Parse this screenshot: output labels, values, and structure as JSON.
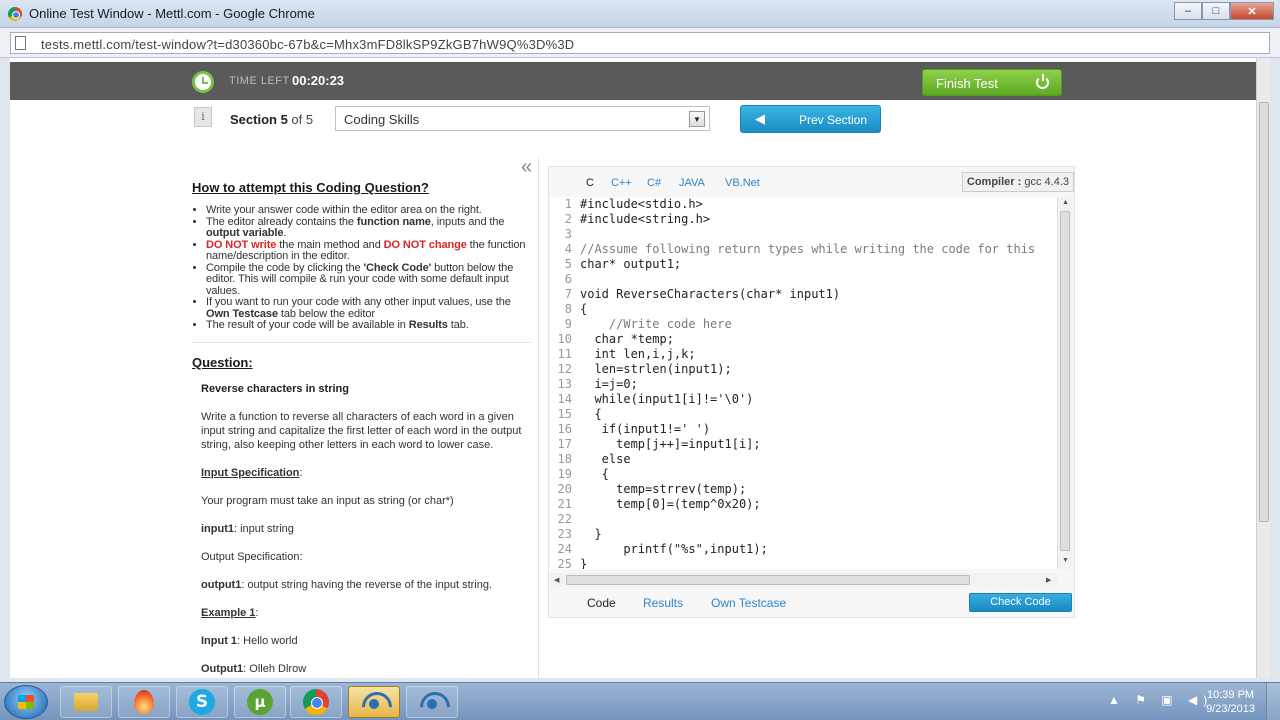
{
  "window": {
    "title": "Online Test Window - Mettl.com - Google Chrome",
    "url": "tests.mettl.com/test-window?t=d30360bc-67b&c=Mhx3mFD8lkSP9ZkGB7hW9Q%3D%3D",
    "buttons": {
      "minimize": "–",
      "maximize": "□",
      "close": "✕"
    }
  },
  "header": {
    "time_label": "TIME LEFT",
    "time_value": "00:20:23",
    "finish_button": "Finish Test"
  },
  "section": {
    "label": "Section 5",
    "of_label": " of 5",
    "select_value": "Coding Skills",
    "prev_button": "Prev Section"
  },
  "instructions": {
    "heading": "How to attempt this Coding Question?",
    "bullets": {
      "b1": "Write your answer code within the editor area on the right.",
      "b2_a": "The editor already contains the ",
      "b2_b": "function name",
      "b2_c": ", inputs and the ",
      "b2_d": "output variable",
      "b2_e": ".",
      "b3_a": "DO NOT write",
      "b3_b": " the main method and ",
      "b3_c": "DO NOT change",
      "b3_d": " the function name/description in the editor.",
      "b4_a": "Compile the code by clicking the ",
      "b4_b": "'Check Code'",
      "b4_c": " button below the editor. This will compile & run your code with some default input values.",
      "b5_a": "If you want to run your code with any other input values, use the ",
      "b5_b": "Own Testcase",
      "b5_c": " tab below the editor",
      "b6_a": "The result of your code will be available in ",
      "b6_b": "Results",
      "b6_c": " tab."
    }
  },
  "question": {
    "heading": "Question:",
    "title": "Reverse characters in string",
    "description": "Write a function to reverse all characters of each word in a given input string and capitalize the first letter of each word in the output string, also keeping other letters in each word to lower case.",
    "input_spec_heading": "Input Specification",
    "input_spec_colon": ":",
    "input_spec_text": "Your program must take an input as string (or char*)",
    "input1_label": "input1",
    "input1_text": ":  input string",
    "output_spec": "Output Specification:",
    "output1_label": "output1",
    "output1_text": ":  output string having the reverse of the input string.",
    "example_heading": "Example 1",
    "example_colon": ":",
    "example_input_label": "Input 1",
    "example_input_text": ": Hello world",
    "example_output_label": "Output1",
    "example_output_text": ": Olleh Dlrow"
  },
  "editor": {
    "tabs": [
      "C",
      "C++",
      "C#",
      "JAVA",
      "VB.Net"
    ],
    "compiler_label": "Compiler :",
    "compiler_value": " gcc 4.4.3",
    "code": [
      {
        "n": "1",
        "t": "#include<stdio.h>"
      },
      {
        "n": "2",
        "t": "#include<string.h>"
      },
      {
        "n": "3",
        "t": ""
      },
      {
        "n": "4",
        "t": "//Assume following return types while writing the code for this"
      },
      {
        "n": "5",
        "t": "char* output1;"
      },
      {
        "n": "6",
        "t": ""
      },
      {
        "n": "7",
        "t": "void ReverseCharacters(char* input1)"
      },
      {
        "n": "8",
        "t": "{"
      },
      {
        "n": "9",
        "t": "    //Write code here"
      },
      {
        "n": "10",
        "t": "  char *temp;"
      },
      {
        "n": "11",
        "t": "  int len,i,j,k;"
      },
      {
        "n": "12",
        "t": "  len=strlen(input1);"
      },
      {
        "n": "13",
        "t": "  i=j=0;"
      },
      {
        "n": "14",
        "t": "  while(input1[i]!='\\0')"
      },
      {
        "n": "15",
        "t": "  {"
      },
      {
        "n": "16",
        "t": "   if(input1!=' ')"
      },
      {
        "n": "17",
        "t": "     temp[j++]=input1[i];"
      },
      {
        "n": "18",
        "t": "   else"
      },
      {
        "n": "19",
        "t": "   {"
      },
      {
        "n": "20",
        "t": "     temp=strrev(temp);"
      },
      {
        "n": "21",
        "t": "     temp[0]=(temp^0x20);"
      },
      {
        "n": "22",
        "t": ""
      },
      {
        "n": "23",
        "t": "  }"
      },
      {
        "n": "24",
        "t": "      printf(\"%s\",input1);"
      },
      {
        "n": "25",
        "t": "}"
      }
    ],
    "bottom_tabs": [
      "Code",
      "Results",
      "Own Testcase"
    ],
    "check_button": "Check Code"
  },
  "taskbar": {
    "time": "10:39 PM",
    "date": "9/23/2013",
    "tray": "▲ ⚑ ▣ ◀)"
  }
}
